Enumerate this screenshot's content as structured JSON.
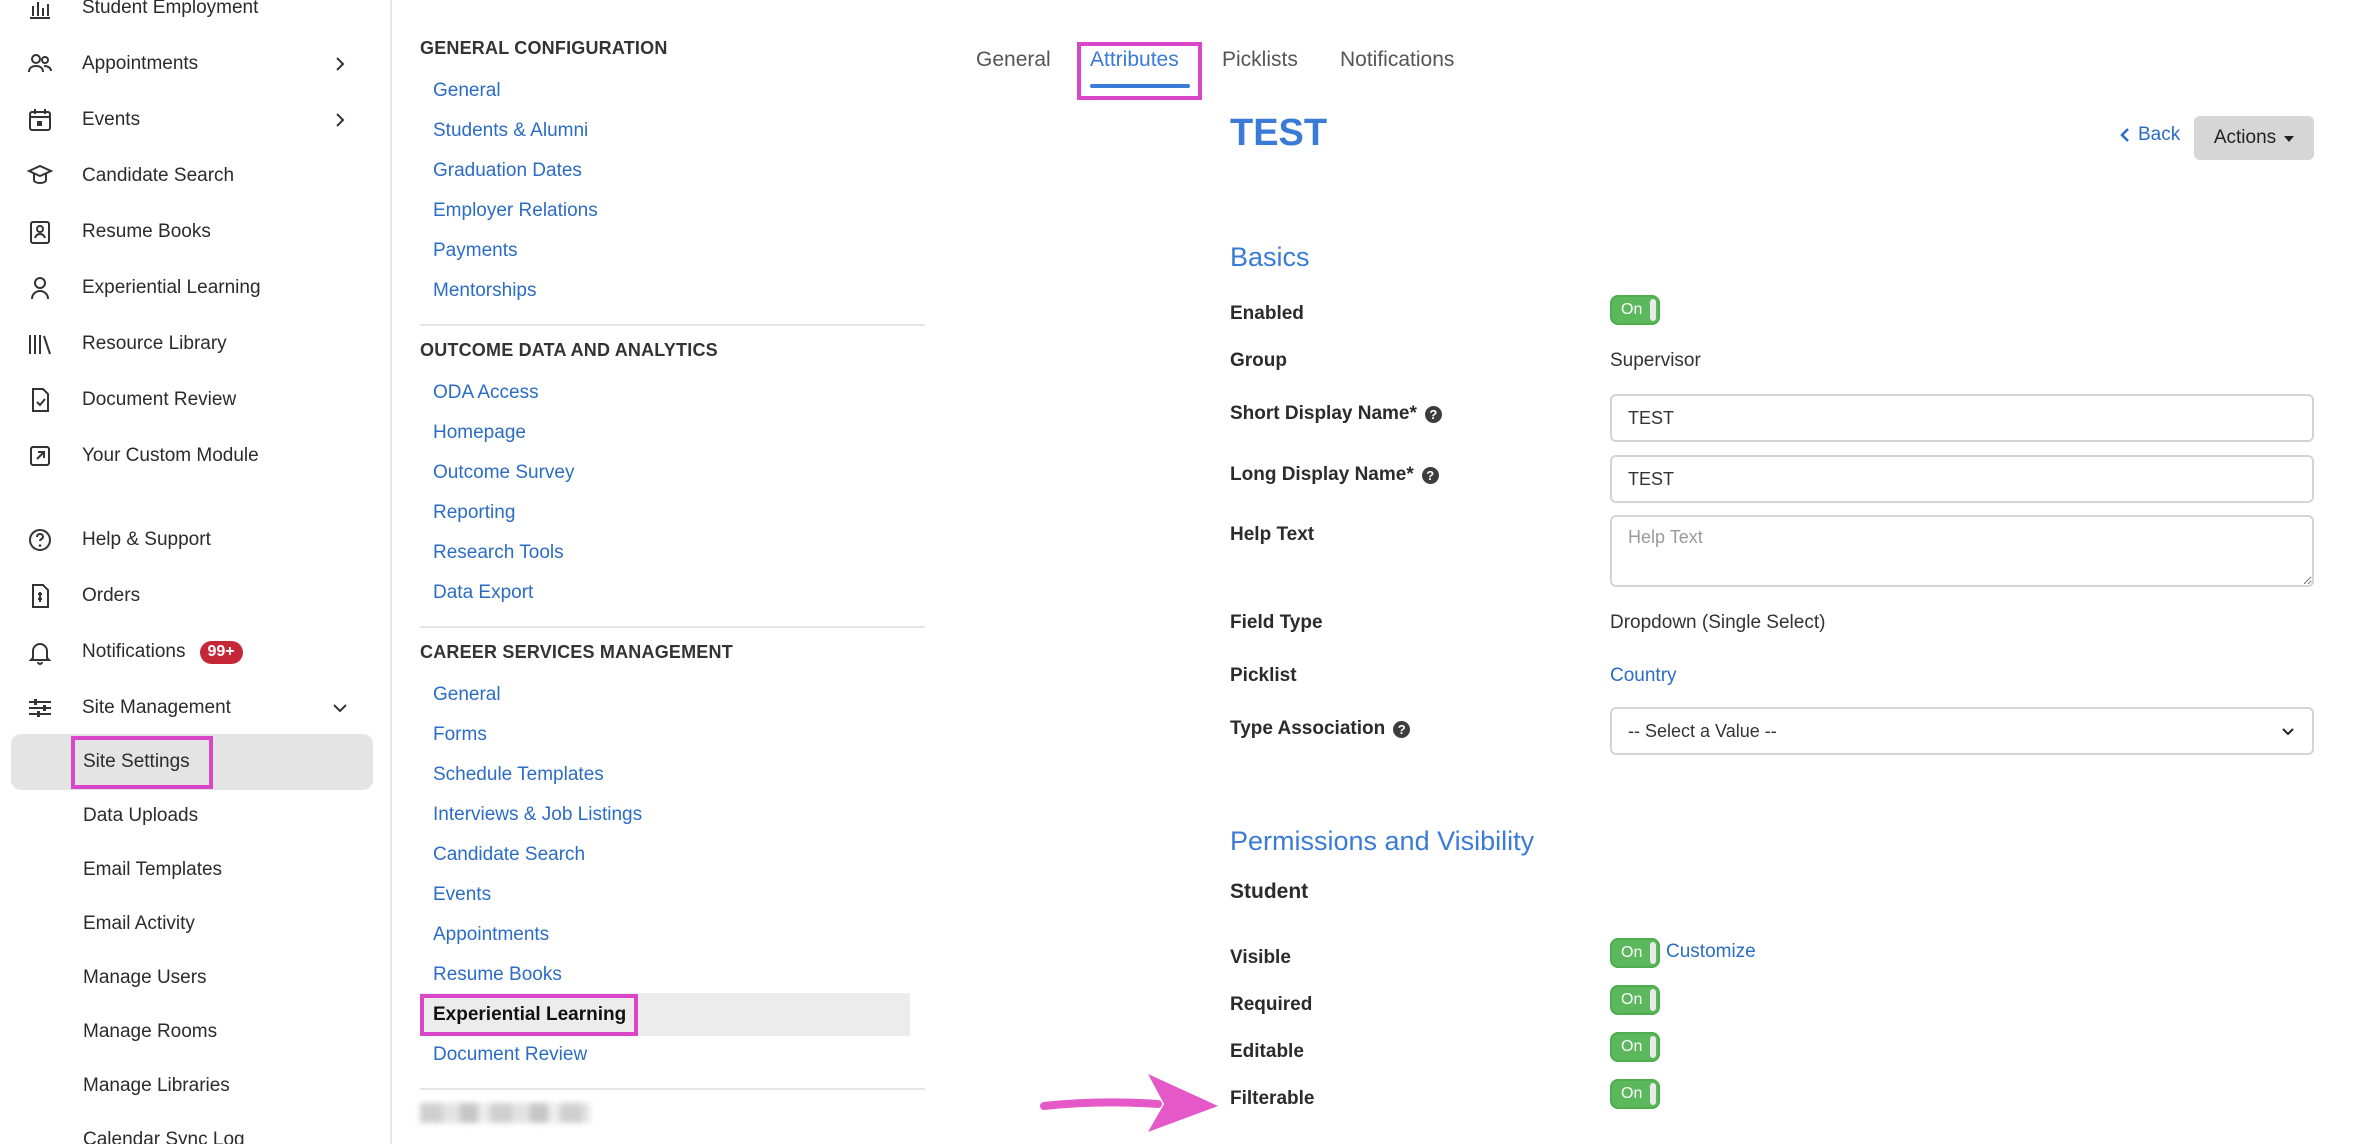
{
  "nav": {
    "items": [
      {
        "label": "Student Employment",
        "icon": "bar-chart-icon"
      },
      {
        "label": "Appointments",
        "icon": "users-icon"
      },
      {
        "label": "Events",
        "icon": "calendar-icon"
      },
      {
        "label": "Candidate Search",
        "icon": "graduate-icon"
      },
      {
        "label": "Resume Books",
        "icon": "resume-icon"
      },
      {
        "label": "Experiential Learning",
        "icon": "learner-icon"
      },
      {
        "label": "Resource Library",
        "icon": "library-icon"
      },
      {
        "label": "Document Review",
        "icon": "document-icon"
      },
      {
        "label": "Your Custom Module",
        "icon": "external-icon"
      },
      {
        "label": "Help & Support",
        "icon": "help-icon"
      },
      {
        "label": "Orders",
        "icon": "receipt-icon"
      },
      {
        "label": "Notifications",
        "icon": "bell-icon",
        "badge": "99+"
      },
      {
        "label": "Site Management",
        "icon": "sliders-icon"
      }
    ],
    "sub_items": [
      "Site Settings",
      "Data Uploads",
      "Email Templates",
      "Email Activity",
      "Manage Users",
      "Manage Rooms",
      "Manage Libraries",
      "Calendar Sync Log"
    ]
  },
  "settings": {
    "sections": [
      {
        "title": "GENERAL CONFIGURATION",
        "links": [
          "General",
          "Students & Alumni",
          "Graduation Dates",
          "Employer Relations",
          "Payments",
          "Mentorships"
        ]
      },
      {
        "title": "OUTCOME DATA AND ANALYTICS",
        "links": [
          "ODA Access",
          "Homepage",
          "Outcome Survey",
          "Reporting",
          "Research Tools",
          "Data Export"
        ]
      },
      {
        "title": "CAREER SERVICES MANAGEMENT",
        "links": [
          "General",
          "Forms",
          "Schedule Templates",
          "Interviews & Job Listings",
          "Candidate Search",
          "Events",
          "Appointments",
          "Resume Books",
          "Experiential Learning",
          "Document Review"
        ]
      }
    ]
  },
  "tabs": [
    "General",
    "Attributes",
    "Picklists",
    "Notifications"
  ],
  "detail": {
    "title": "TEST",
    "back_label": "Back",
    "actions_label": "Actions",
    "basics_heading": "Basics",
    "enabled_label": "Enabled",
    "enabled_value": "On",
    "group_label": "Group",
    "group_value": "Supervisor",
    "short_name_label": "Short Display Name*",
    "short_name_value": "TEST",
    "long_name_label": "Long Display Name*",
    "long_name_value": "TEST",
    "help_text_label": "Help Text",
    "help_text_placeholder": "Help Text",
    "field_type_label": "Field Type",
    "field_type_value": "Dropdown (Single Select)",
    "picklist_label": "Picklist",
    "picklist_value": "Country",
    "type_assoc_label": "Type Association",
    "type_assoc_value": "-- Select a Value --",
    "perm_heading": "Permissions and Visibility",
    "student_label": "Student",
    "visible_label": "Visible",
    "visible_value": "On",
    "customize_label": "Customize",
    "required_label": "Required",
    "required_value": "On",
    "editable_label": "Editable",
    "editable_value": "On",
    "filterable_label": "Filterable",
    "filterable_value": "On"
  },
  "colors": {
    "accent": "#3a7bd5",
    "link": "#2b6cc4",
    "highlight": "#d946c8",
    "toggle_on": "#5cb85c",
    "badge": "#c62737"
  }
}
